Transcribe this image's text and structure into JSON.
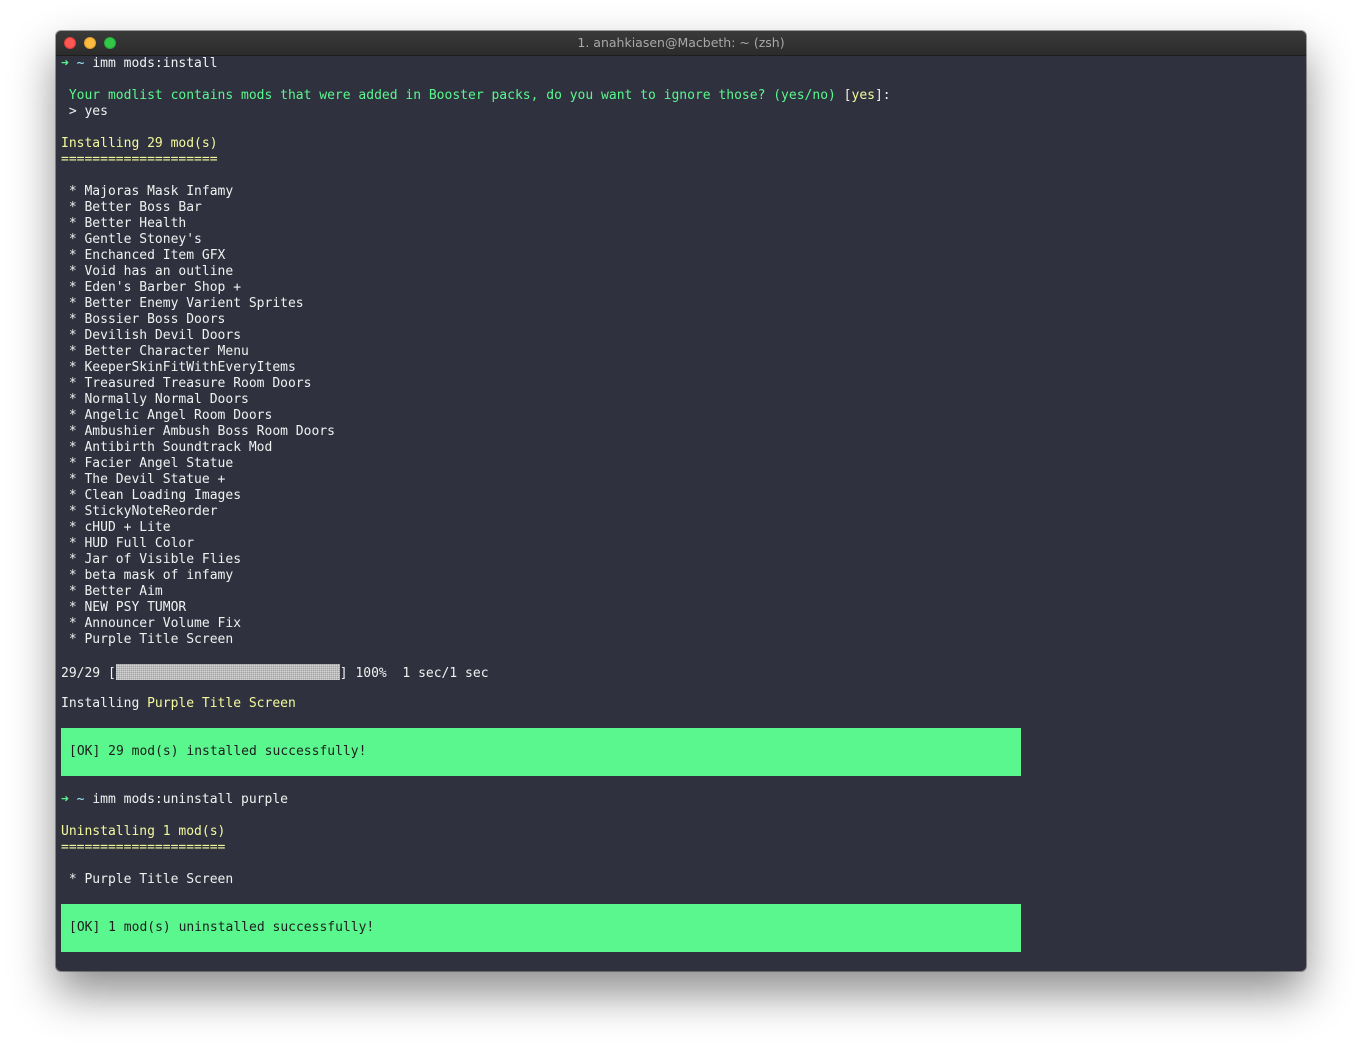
{
  "window": {
    "title": "1. anahkiasen@Macbeth: ~ (zsh)"
  },
  "session1": {
    "prompt_arrow": "➜",
    "cwd": "~",
    "command": "imm mods:install",
    "question": "Your modlist contains mods that were added in Booster packs, do you want to ignore those? (yes/no)",
    "default_open": "[",
    "default_value": "yes",
    "default_close": "]:",
    "answer": "> yes",
    "heading": "Installing 29 mod(s)",
    "underline": "====================",
    "bullet": "*",
    "mods": [
      "Majoras Mask Infamy",
      "Better Boss Bar",
      "Better Health",
      "Gentle Stoney's",
      "Enchanced Item GFX",
      "Void has an outline",
      "Eden's Barber Shop +",
      "Better Enemy Varient Sprites",
      "Bossier Boss Doors",
      "Devilish Devil Doors",
      "Better Character Menu",
      "KeeperSkinFitWithEveryItems",
      "Treasured Treasure Room Doors",
      "Normally Normal Doors",
      "Angelic Angel Room Doors",
      "Ambushier Ambush Boss Room Doors",
      "Antibirth Soundtrack Mod",
      "Facier Angel Statue",
      "The Devil Statue +",
      "Clean Loading Images",
      "StickyNoteReorder",
      "cHUD + Lite",
      "HUD Full Color",
      "Jar of Visible Flies",
      "beta mask of infamy",
      "Better Aim",
      "NEW PSY TUMOR",
      "Announcer Volume Fix",
      "Purple Title Screen"
    ],
    "progress": {
      "count": "29/29",
      "open_bracket": "[",
      "close_bracket": "]",
      "percent_text": "100%",
      "fraction": 1.0,
      "time": "1 sec/1 sec"
    },
    "installing_label": "Installing",
    "installing_mod": "Purple Title Screen",
    "ok_message": "[OK] 29 mod(s) installed successfully!"
  },
  "session2": {
    "prompt_arrow": "➜",
    "cwd": "~",
    "command": "imm mods:uninstall purple",
    "heading": "Uninstalling 1 mod(s)",
    "underline": "=====================",
    "bullet": "*",
    "mods": [
      "Purple Title Screen"
    ],
    "ok_message": "[OK] 1 mod(s) uninstalled successfully!"
  },
  "colors": {
    "terminal_bg": "#2f323e",
    "prompt_green": "#5af78e",
    "heading_yellow": "#f3f99d",
    "path_cyan": "#9aedfe",
    "ok_bg": "#5af78e"
  }
}
